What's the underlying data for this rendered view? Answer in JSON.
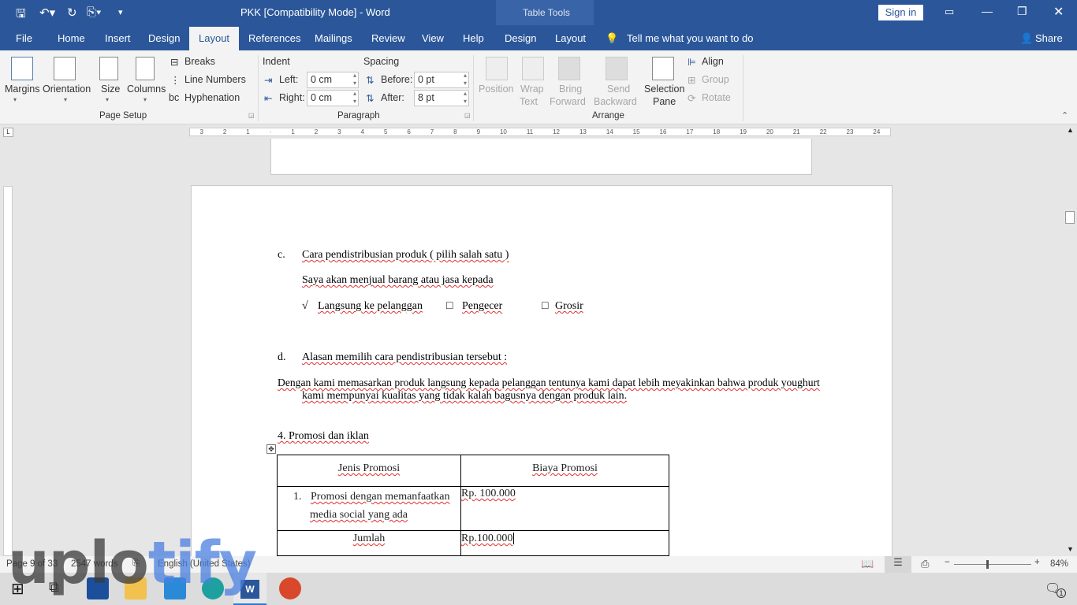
{
  "window": {
    "title": "PKK  [Compatibility Mode]  -  Word",
    "context_tab": "Table Tools",
    "sign_in": "Sign in",
    "share": "Share"
  },
  "quick_access": {
    "save": "save-icon",
    "undo": "undo-icon",
    "redo": "redo-icon",
    "customize": "▾"
  },
  "tabs": [
    "File",
    "Home",
    "Insert",
    "Design",
    "Layout",
    "References",
    "Mailings",
    "Review",
    "View",
    "Help",
    "Design",
    "Layout"
  ],
  "active_tab": "Layout",
  "tell_me": "Tell me what you want to do",
  "ribbon": {
    "page_setup": {
      "label": "Page Setup",
      "margins": "Margins",
      "orientation": "Orientation",
      "size": "Size",
      "columns": "Columns",
      "breaks": "Breaks",
      "line_numbers": "Line Numbers",
      "hyphenation": "Hyphenation"
    },
    "paragraph": {
      "label": "Paragraph",
      "indent": "Indent",
      "left_label": "Left:",
      "left_value": "0 cm",
      "right_label": "Right:",
      "right_value": "0 cm",
      "spacing": "Spacing",
      "before_label": "Before:",
      "before_value": "0 pt",
      "after_label": "After:",
      "after_value": "8 pt"
    },
    "arrange": {
      "label": "Arrange",
      "position": "Position",
      "wrap_text": [
        "Wrap",
        "Text"
      ],
      "bring_forward": [
        "Bring",
        "Forward"
      ],
      "send_backward": [
        "Send",
        "Backward"
      ],
      "selection_pane": [
        "Selection",
        "Pane"
      ],
      "align": "Align",
      "group": "Group",
      "rotate": "Rotate"
    }
  },
  "ruler": [
    "3",
    "2",
    "1",
    "",
    "1",
    "2",
    "3",
    "4",
    "5",
    "6",
    "7",
    "8",
    "9",
    "10",
    "11",
    "12",
    "13",
    "14",
    "15",
    "16",
    "17",
    "18",
    "19",
    "20",
    "21",
    "22",
    "23",
    "24"
  ],
  "document": {
    "c_marker": "c.",
    "c_text": "Cara pendistribusian produk ( pilih  salah satu )",
    "intro": "Saya akan menjual barang atau jasa kepada",
    "options": [
      {
        "mark": "√",
        "label": "Langsung ke pelanggan"
      },
      {
        "mark": "□",
        "label": "Pengecer"
      },
      {
        "mark": "□",
        "label": "Grosir"
      }
    ],
    "d_marker": "d.",
    "d_text": "Alasan memilih cara pendistribusian tersebut :",
    "para_line1": "Dengan kami memasarkan produk langsung kepada pelanggan tentunya kami dapat lebih meyakinkan bahwa produk youghurt",
    "para_line2": "kami mempunyai kualitas yang tidak kalah bagusnya dengan produk lain.",
    "section": "4. Promosi dan iklan",
    "table": {
      "headers": [
        "Jenis Promosi",
        "Biaya Promosi"
      ],
      "rows": [
        {
          "num": "1.",
          "item_line1": "Promosi dengan memanfaatkan",
          "item_line2": "media social yang ada",
          "cost": "Rp. 100.000"
        }
      ],
      "total_label": "Jumlah",
      "total_value": "Rp.100.000"
    }
  },
  "status": {
    "page": "Page 9 of 33",
    "words": "2547 words",
    "language": "English (United States)",
    "zoom": "84%",
    "zoom_level": 84
  },
  "taskbar": {
    "notifications": "1"
  },
  "watermark": {
    "text_a": "uplo",
    "text_b": "tify"
  },
  "colors": {
    "accent": "#2b579a",
    "spell_error": "#e03030"
  }
}
